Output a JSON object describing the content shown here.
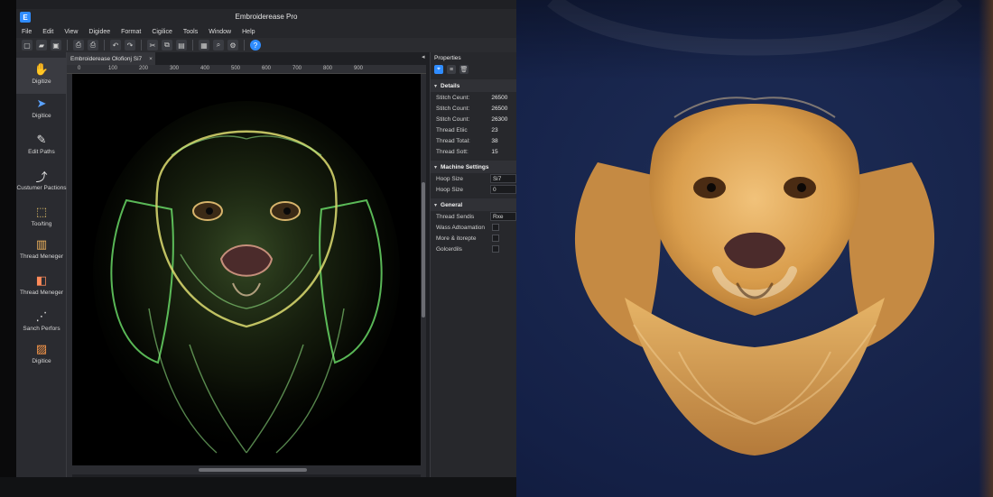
{
  "app": {
    "window_title": "Embroiderease Pro",
    "logo_letter": "E",
    "menu": [
      "File",
      "Edit",
      "View",
      "Digidee",
      "Format",
      "Cigilice",
      "Tools",
      "Window",
      "Help"
    ]
  },
  "toolbar": {
    "icons": [
      {
        "name": "new-file-icon",
        "glyph": "▢"
      },
      {
        "name": "open-folder-icon",
        "glyph": "▰"
      },
      {
        "name": "save-icon",
        "glyph": "▣"
      },
      {
        "name": "print-icon",
        "glyph": "⎙"
      },
      {
        "name": "print-preview-icon",
        "glyph": "⎙"
      },
      {
        "name": "undo-icon",
        "glyph": "↶"
      },
      {
        "name": "redo-icon",
        "glyph": "↷"
      },
      {
        "name": "cut-icon",
        "glyph": "✂"
      },
      {
        "name": "copy-icon",
        "glyph": "⧉"
      },
      {
        "name": "paste-icon",
        "glyph": "▤"
      },
      {
        "name": "grid-icon",
        "glyph": "▦"
      },
      {
        "name": "zoom-icon",
        "glyph": "⌕"
      },
      {
        "name": "settings-icon",
        "glyph": "⚙"
      },
      {
        "name": "help-icon",
        "glyph": "?"
      }
    ]
  },
  "tools": [
    {
      "name": "tool-digitize",
      "icon": "hand-icon",
      "glyph": "✋",
      "label": "Digitize"
    },
    {
      "name": "tool-digitize-select",
      "icon": "cursor-arrow-icon",
      "glyph": "➤",
      "label": "Digitice"
    },
    {
      "name": "tool-edit-paths",
      "icon": "pen-edit-icon",
      "glyph": "✎",
      "label": "Edit Paths"
    },
    {
      "name": "tool-custom-paths",
      "icon": "path-nodes-icon",
      "glyph": "⤴",
      "label": "Custumer Pactions"
    },
    {
      "name": "tool-tracking",
      "icon": "trace-icon",
      "glyph": "⬚",
      "label": "Too/ting"
    },
    {
      "name": "tool-thread-manager",
      "icon": "thread-spool-icon",
      "glyph": "▥",
      "label": "Thread Meneger"
    },
    {
      "name": "tool-thread-manager-2",
      "icon": "thread-color-icon",
      "glyph": "◧",
      "label": "Thread Meneger"
    },
    {
      "name": "tool-stitch-perform",
      "icon": "stitch-icon",
      "glyph": "⋰",
      "label": "Sanch Perfors"
    },
    {
      "name": "tool-digitize-2",
      "icon": "digitize-icon",
      "glyph": "▨",
      "label": "Digitice"
    }
  ],
  "document": {
    "tab_label": "Embroiderease Olofionj Si7",
    "close_glyph": "×",
    "collapse_glyph": "◂",
    "ruler_ticks": [
      "0",
      "100",
      "200",
      "300",
      "400",
      "500",
      "600",
      "700",
      "800",
      "900"
    ]
  },
  "properties": {
    "title": "Properties",
    "details_title": "Details",
    "details": [
      {
        "k": "Stitch Ceunt:",
        "v": "26500"
      },
      {
        "k": "Stitch Count:",
        "v": "26500"
      },
      {
        "k": "Stitch Count:",
        "v": "26300"
      },
      {
        "k": "Thread Etiic",
        "v": "23"
      },
      {
        "k": "Thread Total:",
        "v": "38"
      },
      {
        "k": "Thread Sott:",
        "v": "15"
      }
    ],
    "machine_title": "Machine Settings",
    "machine": [
      {
        "k": "Hoop Size",
        "v": "Si7"
      },
      {
        "k": "Hoop Size",
        "v": "0"
      }
    ],
    "general_title": "General",
    "general_select": {
      "k": "Thread Sendis",
      "v": "Rxe"
    },
    "general_checks": [
      "Wass Adtoamation",
      "More & itorepte",
      "Golcerdils"
    ]
  },
  "photo": {
    "subject": "embroidered-golden-retriever-hoodie"
  }
}
